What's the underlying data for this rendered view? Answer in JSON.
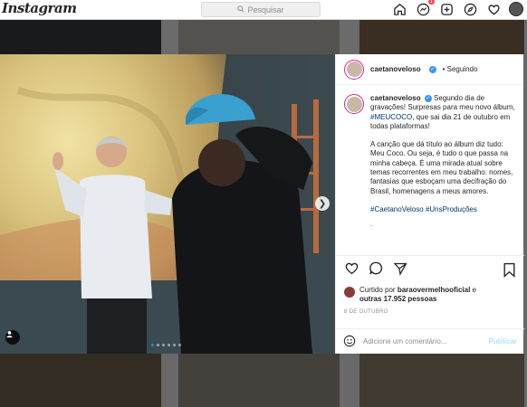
{
  "nav": {
    "logo": "Instagram",
    "search_placeholder": "Pesquisar",
    "notification_count": "1"
  },
  "post": {
    "author": "caetanoveloso",
    "follow_status": "• Seguindo",
    "caption": {
      "intro": "Segundo dia de gravações! Surpresas para meu novo álbum,",
      "hashtag": "#MEUCOCO",
      "rest": ", que sai dia 21 de outubro em todas plataformas!",
      "paragraph2": "A canção que dá título ao álbum diz tudo: Meu Coco. Ou seja, é tudo o que passa na minha cabeça. É uma mirada atual sobre temas recorrentes em meu trabalho: nomes, fantasias que esboçam uma decifração do Brasil, homenagens a meus amores.",
      "tags": "#CaetanoVeloso #UnsProduções",
      "trailing": "."
    },
    "likes": {
      "prefix": "Curtido por",
      "user": "baraovermelhooficial",
      "middle": "e",
      "others": "outras 17.952 pessoas"
    },
    "date": "8 DE OUTUBRO",
    "comment_placeholder": "Adicione um comentário...",
    "publish_label": "Publicar"
  },
  "carousel": {
    "slides": 6,
    "active": 1
  },
  "colors": {
    "accent": "#0095f6",
    "story_ring": "#d6249f",
    "verified": "#3897f0"
  },
  "icons": [
    "home-icon",
    "messenger-icon",
    "new-post-icon",
    "explore-icon",
    "heart-icon",
    "chevron-right-icon",
    "tag-user-icon",
    "comment-icon",
    "share-icon",
    "bookmark-icon",
    "emoji-icon"
  ]
}
